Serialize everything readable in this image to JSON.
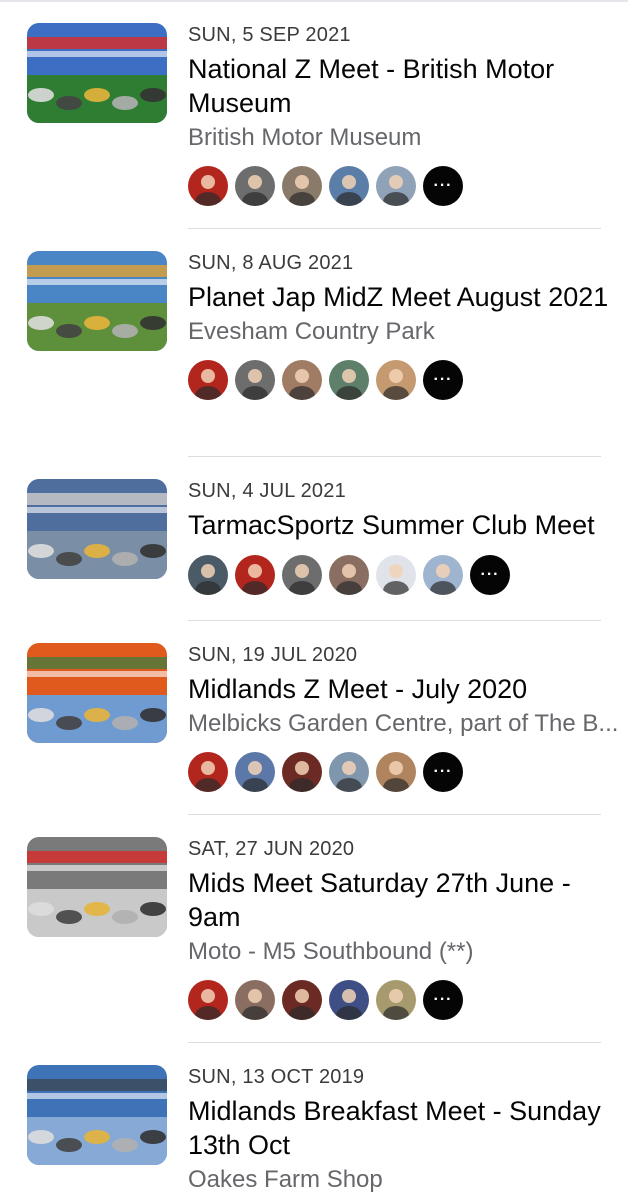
{
  "events": [
    {
      "date": "SUN, 5 SEP 2021",
      "title": "National Z Meet - British Motor Museum",
      "location": "British Motor Museum",
      "thumb_colors": [
        "#3c6ec4",
        "#2e7d32",
        "#d32f2f"
      ],
      "avatar_colors": [
        "#b3261e",
        "#6d6d6d",
        "#8a7a6a",
        "#5a7ea8",
        "#8fa2b8"
      ],
      "more_label": "···"
    },
    {
      "date": "SUN, 8 AUG 2021",
      "title": "Planet Jap MidZ Meet August 2021",
      "location": "Evesham Country Park",
      "thumb_colors": [
        "#4a86c5",
        "#5e8f3a",
        "#d9a03a"
      ],
      "avatar_colors": [
        "#b3261e",
        "#6d6d6d",
        "#a07c64",
        "#5e7f6a",
        "#c69a70"
      ],
      "more_label": "···"
    },
    {
      "date": "SUN, 4 JUL 2021",
      "title": "TarmacSportz Summer Club Meet",
      "location": "",
      "thumb_colors": [
        "#4f6e9e",
        "#7a8fa6",
        "#c7c7c7"
      ],
      "avatar_colors": [
        "#4a5a66",
        "#b3261e",
        "#6d6d6d",
        "#8a6e62",
        "#e0e4ea",
        "#9fb4cf"
      ],
      "more_label": "···"
    },
    {
      "date": "SUN, 19 JUL 2020",
      "title": "Midlands Z Meet - July 2020",
      "location": "Melbicks Garden Centre, part of The B...",
      "thumb_colors": [
        "#e05a1e",
        "#6f9bd1",
        "#4f7a3a"
      ],
      "avatar_colors": [
        "#b3261e",
        "#5b78a8",
        "#6b2a24",
        "#7f96ad",
        "#b0845e"
      ],
      "more_label": "···"
    },
    {
      "date": "SAT, 27 JUN 2020",
      "title": "Mids Meet Saturday 27th June - 9am",
      "location": "Moto - M5 Southbound (**)",
      "thumb_colors": [
        "#7a7a7a",
        "#c9c9c9",
        "#d32f2f"
      ],
      "avatar_colors": [
        "#b3261e",
        "#8a6e62",
        "#6b2a24",
        "#3e4f86",
        "#a69a6e"
      ],
      "more_label": "···"
    },
    {
      "date": "SUN, 13 OCT 2019",
      "title": "Midlands Breakfast Meet - Sunday 13th Oct",
      "location": "Oakes Farm Shop",
      "thumb_colors": [
        "#3f73b8",
        "#86a9d6",
        "#3d4a5c"
      ],
      "avatar_colors": [],
      "more_label": ""
    }
  ]
}
